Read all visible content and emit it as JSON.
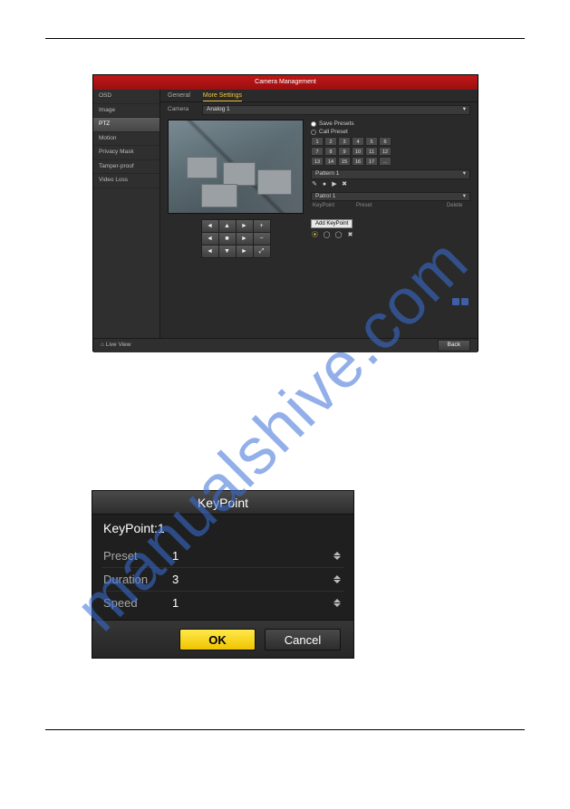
{
  "watermark": "manualshive.com",
  "cam": {
    "title": "Camera Management",
    "sidebar": [
      {
        "label": "OSD"
      },
      {
        "label": "Image"
      },
      {
        "label": "PTZ",
        "selected": true
      },
      {
        "label": "Motion"
      },
      {
        "label": "Privacy Mask"
      },
      {
        "label": "Tamper-proof"
      },
      {
        "label": "Video Loss"
      }
    ],
    "tabs": {
      "general": "General",
      "more": "More Settings"
    },
    "camera": {
      "label": "Camera",
      "value": "Analog 1"
    },
    "save_presets": "Save Presets",
    "call_preset": "Call Preset",
    "presets": [
      "1",
      "2",
      "3",
      "4",
      "5",
      "6",
      "7",
      "8",
      "9",
      "10",
      "11",
      "12",
      "13",
      "14",
      "15",
      "16",
      "17",
      "..."
    ],
    "pattern": {
      "label": "Pattern",
      "value": "1"
    },
    "patrol": {
      "label": "Patrol",
      "value": "1"
    },
    "patrol_hdr": {
      "c1": "KeyPoint",
      "c2": "Preset",
      "c3": "Delete"
    },
    "ptz": [
      "◄",
      "▲",
      "►",
      "+",
      "◄",
      "■",
      "►",
      "−",
      "◄",
      "▼",
      "►",
      "⤢"
    ],
    "add_keypoint": "Add KeyPoint",
    "live_view": "Live View",
    "back": "Back"
  },
  "dlg": {
    "title": "KeyPoint",
    "line": "KeyPoint:1",
    "rows": [
      {
        "label": "Preset",
        "value": "1"
      },
      {
        "label": "Duration",
        "value": "3"
      },
      {
        "label": "Speed",
        "value": "1"
      }
    ],
    "ok": "OK",
    "cancel": "Cancel"
  }
}
